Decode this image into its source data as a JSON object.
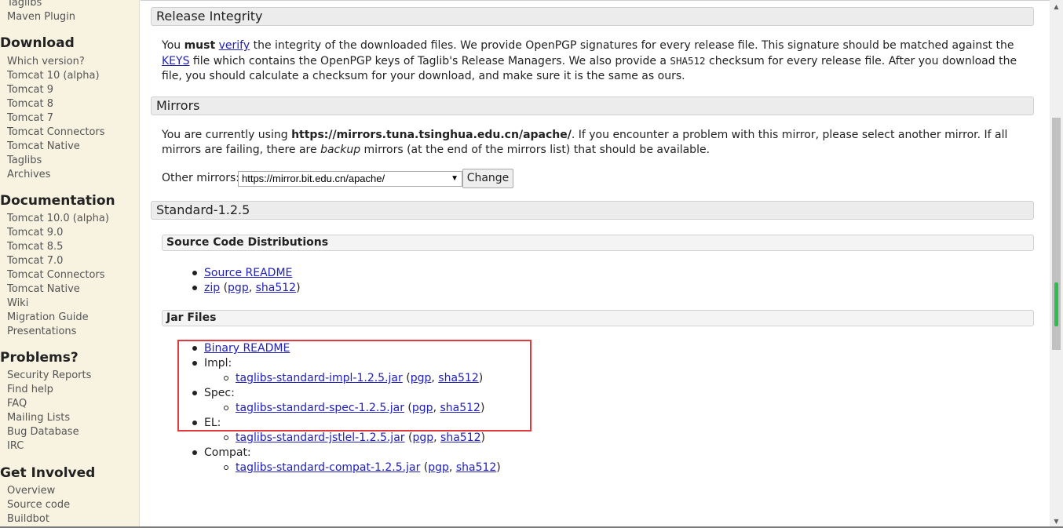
{
  "sidebar": {
    "top_items": [
      "Taglibs",
      "Maven Plugin"
    ],
    "sections": [
      {
        "title": "Download",
        "items": [
          "Which version?",
          "Tomcat 10 (alpha)",
          "Tomcat 9",
          "Tomcat 8",
          "Tomcat 7",
          "Tomcat Connectors",
          "Tomcat Native",
          "Taglibs",
          "Archives"
        ]
      },
      {
        "title": "Documentation",
        "items": [
          "Tomcat 10.0 (alpha)",
          "Tomcat 9.0",
          "Tomcat 8.5",
          "Tomcat 7.0",
          "Tomcat Connectors",
          "Tomcat Native",
          "Wiki",
          "Migration Guide",
          "Presentations"
        ]
      },
      {
        "title": "Problems?",
        "items": [
          "Security Reports",
          "Find help",
          "FAQ",
          "Mailing Lists",
          "Bug Database",
          "IRC"
        ]
      },
      {
        "title": "Get Involved",
        "items": [
          "Overview",
          "Source code",
          "Buildbot"
        ]
      }
    ]
  },
  "release_integrity": {
    "title": "Release Integrity",
    "p1": "You ",
    "must": "must",
    "p2": " ",
    "verify": "verify",
    "p3": " the integrity of the downloaded files. We provide OpenPGP signatures for every release file. This signature should be matched against the ",
    "keys": "KEYS",
    "p4": " file which contains the OpenPGP keys of Taglib's Release Managers. We also provide a ",
    "sha512": "SHA512",
    "p5": " checksum for every release file. After you download the file, you should calculate a checksum for your download, and make sure it is the same as ours."
  },
  "mirrors": {
    "title": "Mirrors",
    "p1": "You are currently using ",
    "current": "https://mirrors.tuna.tsinghua.edu.cn/apache/",
    "p2": ". If you encounter a problem with this mirror, please select another mirror. If all mirrors are failing, there are ",
    "backup": "backup",
    "p3": " mirrors (at the end of the mirrors list) that should be available.",
    "other_label": "Other mirrors:",
    "selected": "https://mirror.bit.edu.cn/apache/",
    "change_label": "Change"
  },
  "standard": {
    "title": "Standard-1.2.5",
    "source_title": "Source Code Distributions",
    "source_readme": "Source README",
    "zip": "zip",
    "pgp": "pgp",
    "sha512": "sha512",
    "jar_title": "Jar Files",
    "binary_readme": "Binary README",
    "jars": [
      {
        "label": "Impl:",
        "file": "taglibs-standard-impl-1.2.5.jar"
      },
      {
        "label": "Spec:",
        "file": "taglibs-standard-spec-1.2.5.jar"
      },
      {
        "label": "EL:",
        "file": "taglibs-standard-jstlel-1.2.5.jar"
      },
      {
        "label": "Compat:",
        "file": "taglibs-standard-compat-1.2.5.jar"
      }
    ],
    "open_paren": " (",
    "comma": ", ",
    "close_paren": ")"
  },
  "colors": {
    "sidebar_bg": "#f8f2e0",
    "link": "#2020bb",
    "highlight": "#e0393e",
    "scroll_marker": "#2ebd4e"
  }
}
